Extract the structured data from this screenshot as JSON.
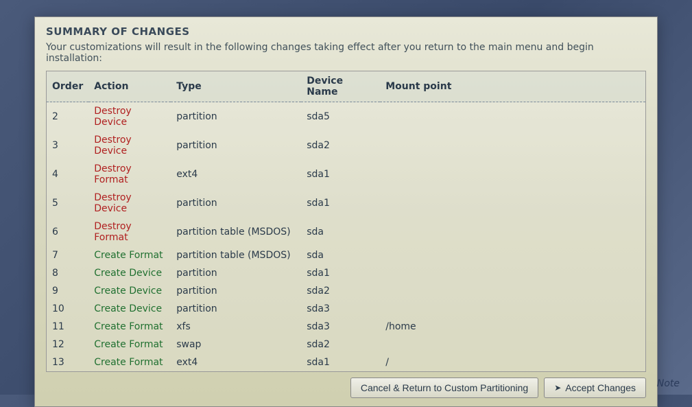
{
  "dialog": {
    "title": "SUMMARY OF CHANGES",
    "subtitle": "Your customizations will result in the following changes taking effect after you return to the main menu and begin installation:"
  },
  "table": {
    "headers": {
      "order": "Order",
      "action": "Action",
      "type": "Type",
      "device": "Device Name",
      "mount": "Mount point"
    },
    "rows": [
      {
        "order": "2",
        "action": "Destroy Device",
        "action_kind": "destroy",
        "type": "partition",
        "device": "sda5",
        "mount": ""
      },
      {
        "order": "3",
        "action": "Destroy Device",
        "action_kind": "destroy",
        "type": "partition",
        "device": "sda2",
        "mount": ""
      },
      {
        "order": "4",
        "action": "Destroy Format",
        "action_kind": "destroy",
        "type": "ext4",
        "device": "sda1",
        "mount": ""
      },
      {
        "order": "5",
        "action": "Destroy Device",
        "action_kind": "destroy",
        "type": "partition",
        "device": "sda1",
        "mount": ""
      },
      {
        "order": "6",
        "action": "Destroy Format",
        "action_kind": "destroy",
        "type": "partition table (MSDOS)",
        "device": "sda",
        "mount": ""
      },
      {
        "order": "7",
        "action": "Create Format",
        "action_kind": "create",
        "type": "partition table (MSDOS)",
        "device": "sda",
        "mount": ""
      },
      {
        "order": "8",
        "action": "Create Device",
        "action_kind": "create",
        "type": "partition",
        "device": "sda1",
        "mount": ""
      },
      {
        "order": "9",
        "action": "Create Device",
        "action_kind": "create",
        "type": "partition",
        "device": "sda2",
        "mount": ""
      },
      {
        "order": "10",
        "action": "Create Device",
        "action_kind": "create",
        "type": "partition",
        "device": "sda3",
        "mount": ""
      },
      {
        "order": "11",
        "action": "Create Format",
        "action_kind": "create",
        "type": "xfs",
        "device": "sda3",
        "mount": "/home"
      },
      {
        "order": "12",
        "action": "Create Format",
        "action_kind": "create",
        "type": "swap",
        "device": "sda2",
        "mount": ""
      },
      {
        "order": "13",
        "action": "Create Format",
        "action_kind": "create",
        "type": "ext4",
        "device": "sda1",
        "mount": "/"
      }
    ]
  },
  "buttons": {
    "cancel": "Cancel & Return to Custom Partitioning",
    "accept": "Accept Changes"
  },
  "footer": {
    "note": "Note"
  }
}
